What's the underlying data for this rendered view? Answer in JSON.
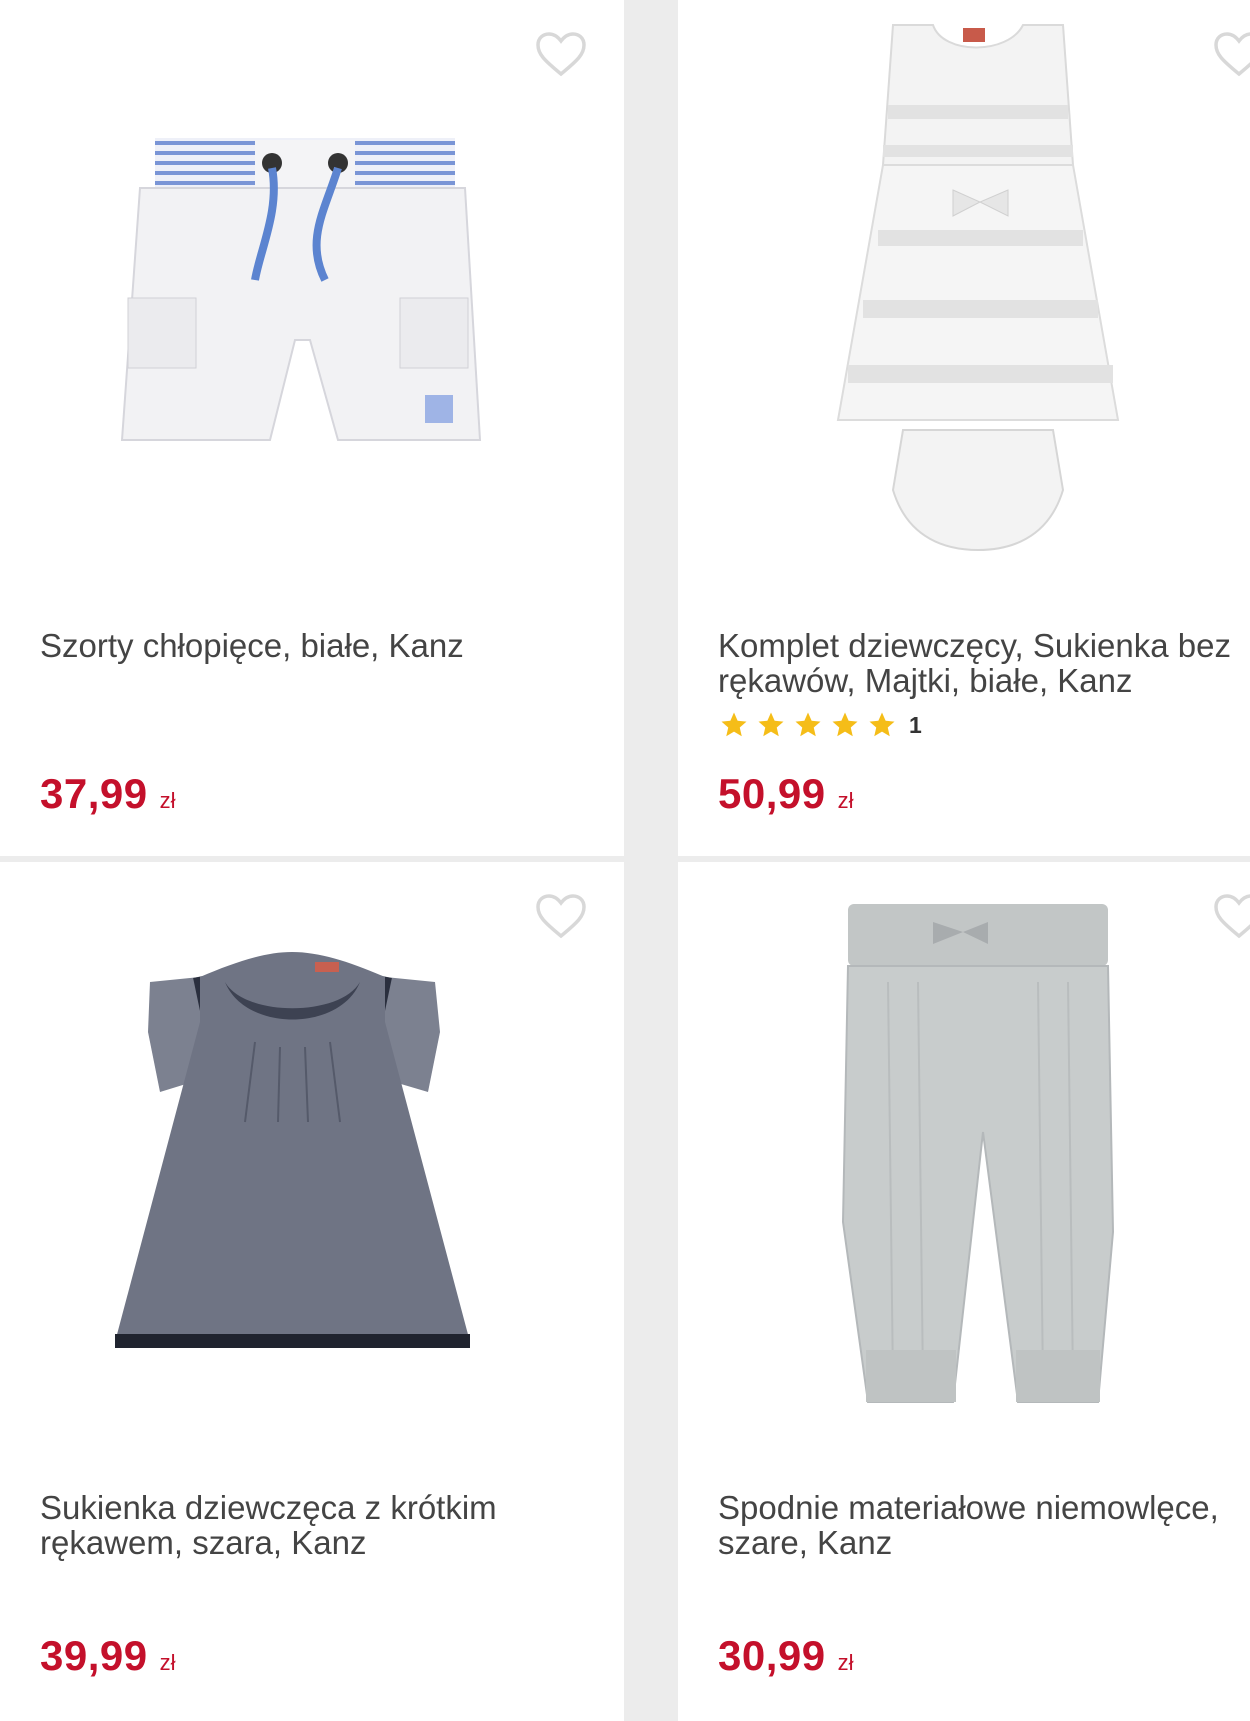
{
  "colors": {
    "price": "#c4102b",
    "star": "#f5bd18",
    "background": "#ececec",
    "card": "#ffffff"
  },
  "products": [
    {
      "title": "Szorty chłopięce, białe, Kanz",
      "price": "37,99",
      "currency": "zł",
      "image": "white-boys-shorts",
      "favorite_icon": "heart-outline-icon"
    },
    {
      "title": "Komplet dziewczęcy, Sukienka bez rękawów, Majtki, białe, Kanz",
      "rating_stars": 5,
      "rating_count": "1",
      "price": "50,99",
      "currency": "zł",
      "image": "white-girls-dress-set",
      "favorite_icon": "heart-outline-icon"
    },
    {
      "title": "Sukienka dziewczęca z krótkim rękawem, szara, Kanz",
      "price": "39,99",
      "currency": "zł",
      "image": "grey-girls-dress",
      "favorite_icon": "heart-outline-icon"
    },
    {
      "title": "Spodnie materiałowe niemowlęce, szare, Kanz",
      "price": "30,99",
      "currency": "zł",
      "image": "grey-baby-trousers",
      "favorite_icon": "heart-outline-icon"
    }
  ]
}
